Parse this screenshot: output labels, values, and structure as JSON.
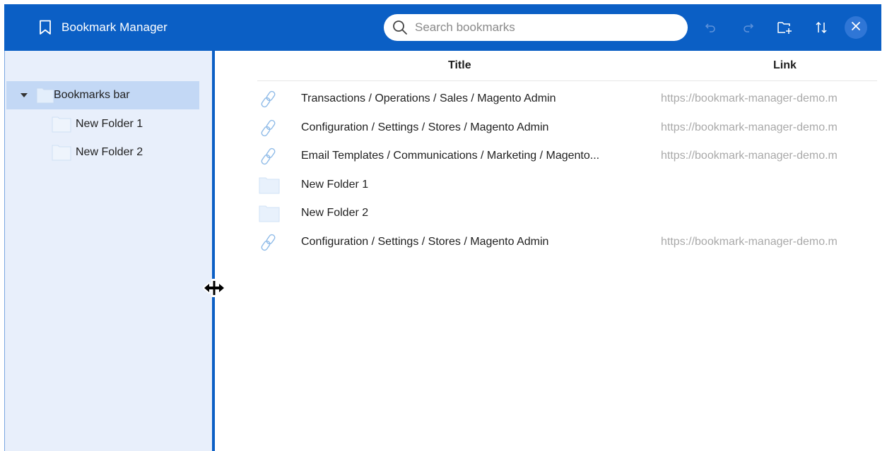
{
  "header": {
    "app_title": "Bookmark Manager",
    "search_placeholder": "Search bookmarks",
    "search_value": "",
    "bg_color": "#0b5fc5",
    "toolbar": [
      "undo-icon",
      "redo-icon",
      "new-folder-icon",
      "sort-icon",
      "close-icon"
    ]
  },
  "sidebar": {
    "root": {
      "label": "Bookmarks bar",
      "expanded": true,
      "selected": true
    },
    "children": [
      {
        "label": "New Folder 1"
      },
      {
        "label": "New Folder 2"
      }
    ]
  },
  "list": {
    "columns": {
      "title": "Title",
      "link": "Link"
    },
    "rows": [
      {
        "type": "link",
        "title": "Transactions / Operations / Sales / Magento Admin",
        "link": "https://bookmark-manager-demo.m"
      },
      {
        "type": "link",
        "title": "Configuration / Settings / Stores / Magento Admin",
        "link": "https://bookmark-manager-demo.m"
      },
      {
        "type": "link",
        "title": "Email Templates / Communications / Marketing / Magento...",
        "link": "https://bookmark-manager-demo.m"
      },
      {
        "type": "folder",
        "title": "New Folder 1",
        "link": ""
      },
      {
        "type": "folder",
        "title": "New Folder 2",
        "link": ""
      },
      {
        "type": "link",
        "title": "Configuration / Settings / Stores / Magento Admin",
        "link": "https://bookmark-manager-demo.m"
      }
    ]
  }
}
